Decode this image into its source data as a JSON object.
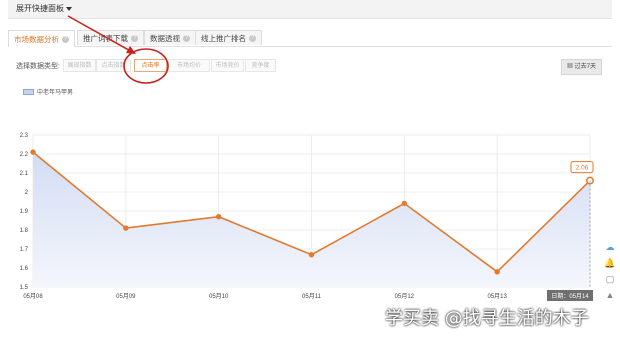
{
  "top_panel": {
    "toggle_label": "展开快捷面板"
  },
  "tabs": [
    {
      "label": "市场数据分析",
      "active": true
    },
    {
      "label": "推广词表下载",
      "active": false
    },
    {
      "label": "数据透视",
      "active": false
    },
    {
      "label": "线上推广排名",
      "active": false
    }
  ],
  "filter": {
    "label": "选择数据类型:",
    "options": [
      "展现指数",
      "点击指数",
      "点击率",
      "市场均价",
      "市场竞价",
      "竞争度"
    ],
    "selected_index": 2,
    "period_button": "过去7天"
  },
  "annotation_color": "#c8211a",
  "accent_color": "#e2731b",
  "chart_data": {
    "type": "area",
    "legend": [
      "中老年马甲男"
    ],
    "x": [
      "05月08",
      "05月09",
      "05月10",
      "05月11",
      "05月12",
      "05月13",
      "05月14"
    ],
    "series": [
      {
        "name": "中老年马甲男",
        "values": [
          2.21,
          1.81,
          1.87,
          1.67,
          1.94,
          1.58,
          2.06
        ]
      }
    ],
    "yticks": [
      "2.3",
      "2.2",
      "2.1",
      "2",
      "1.9",
      "1.8",
      "1.7",
      "1.6",
      "1.5"
    ],
    "ylim": [
      1.5,
      2.3
    ],
    "tooltip_value": "2.06",
    "hover_label": "日期：05月14",
    "line_color": "#e27a2d",
    "fill_color": "#dfe6f7",
    "grid": true
  },
  "side_icons": [
    "cloud-icon",
    "bell-icon",
    "chat-icon",
    "up-arrow-icon"
  ],
  "watermark": "学买卖 @找寻生活的木子"
}
